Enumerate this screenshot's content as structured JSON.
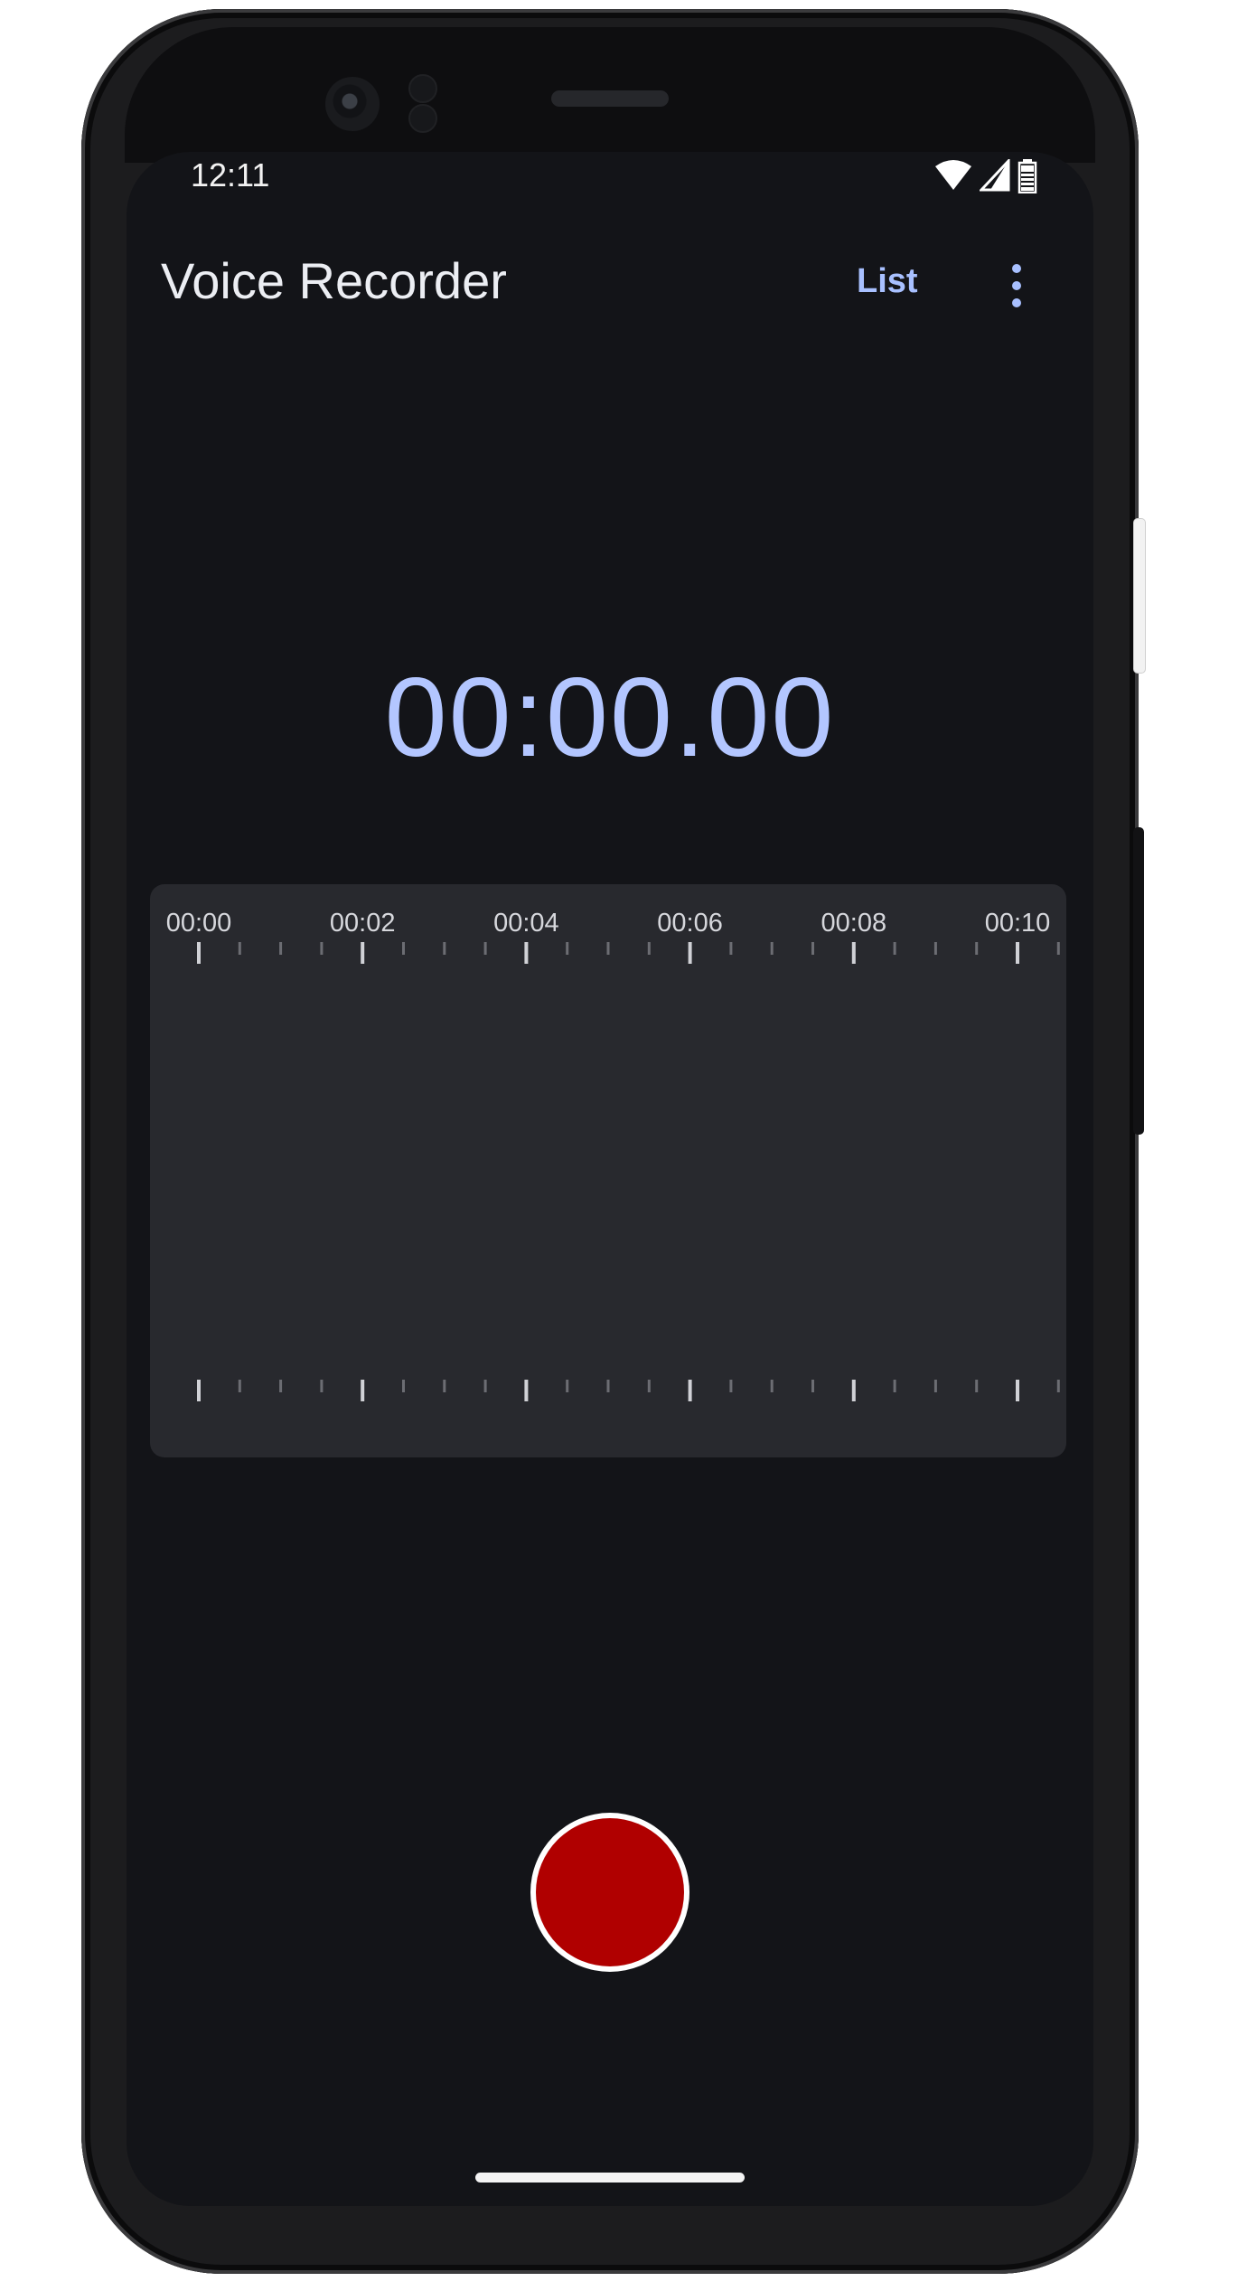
{
  "status_bar": {
    "time": "12:11",
    "icons": [
      "wifi-icon",
      "cell-signal-icon",
      "battery-icon"
    ]
  },
  "app_bar": {
    "title": "Voice Recorder",
    "list_label": "List",
    "overflow_icon": "more-vert-icon"
  },
  "timer": {
    "value": "00:00.00"
  },
  "waveform": {
    "time_labels": [
      "00:00",
      "00:02",
      "00:04",
      "00:06",
      "00:08",
      "00:10"
    ]
  },
  "record_button": {
    "icon": "record-icon"
  },
  "colors": {
    "background": "#131418",
    "accent": "#b3c6ff",
    "record": "#b00000",
    "waveform_bg": "#28292e"
  }
}
